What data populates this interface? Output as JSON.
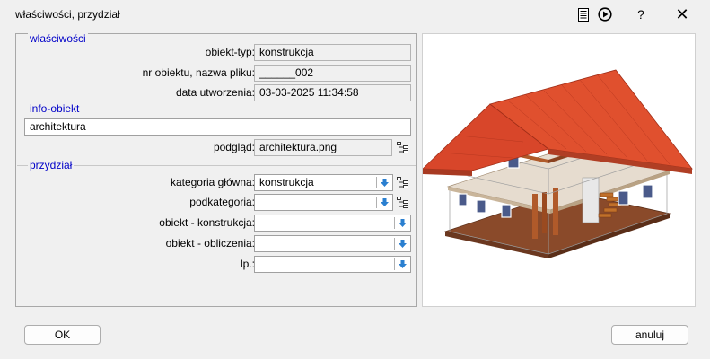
{
  "window": {
    "title": "właściwości, przydział",
    "help_label": "?",
    "close_label": "✕"
  },
  "sections": {
    "wlasciwosci": {
      "title": "właściwości",
      "rows": [
        {
          "label": "obiekt-typ:",
          "value": "konstrukcja"
        },
        {
          "label": "nr obiektu, nazwa pliku:",
          "value": "______002"
        },
        {
          "label": "data utworzenia:",
          "value": "03-03-2025 11:34:58"
        }
      ]
    },
    "info": {
      "title": "info-obiekt",
      "text_value": "architektura",
      "preview_label": "podgląd:",
      "preview_value": "architektura.png"
    },
    "przydzial": {
      "title": "przydział",
      "rows": [
        {
          "label": "kategoria główna:",
          "value": "konstrukcja"
        },
        {
          "label": "podkategoria:",
          "value": ""
        },
        {
          "label": "obiekt - konstrukcja:",
          "value": ""
        },
        {
          "label": "obiekt - obliczenia:",
          "value": ""
        },
        {
          "label": "lp.:",
          "value": ""
        }
      ]
    }
  },
  "buttons": {
    "ok": "OK",
    "cancel": "anuluj"
  },
  "colors": {
    "group_title": "#0000c8",
    "roof": "#d8462a",
    "wood": "#b05a2a",
    "arrow_blue": "#2a7fd0"
  }
}
